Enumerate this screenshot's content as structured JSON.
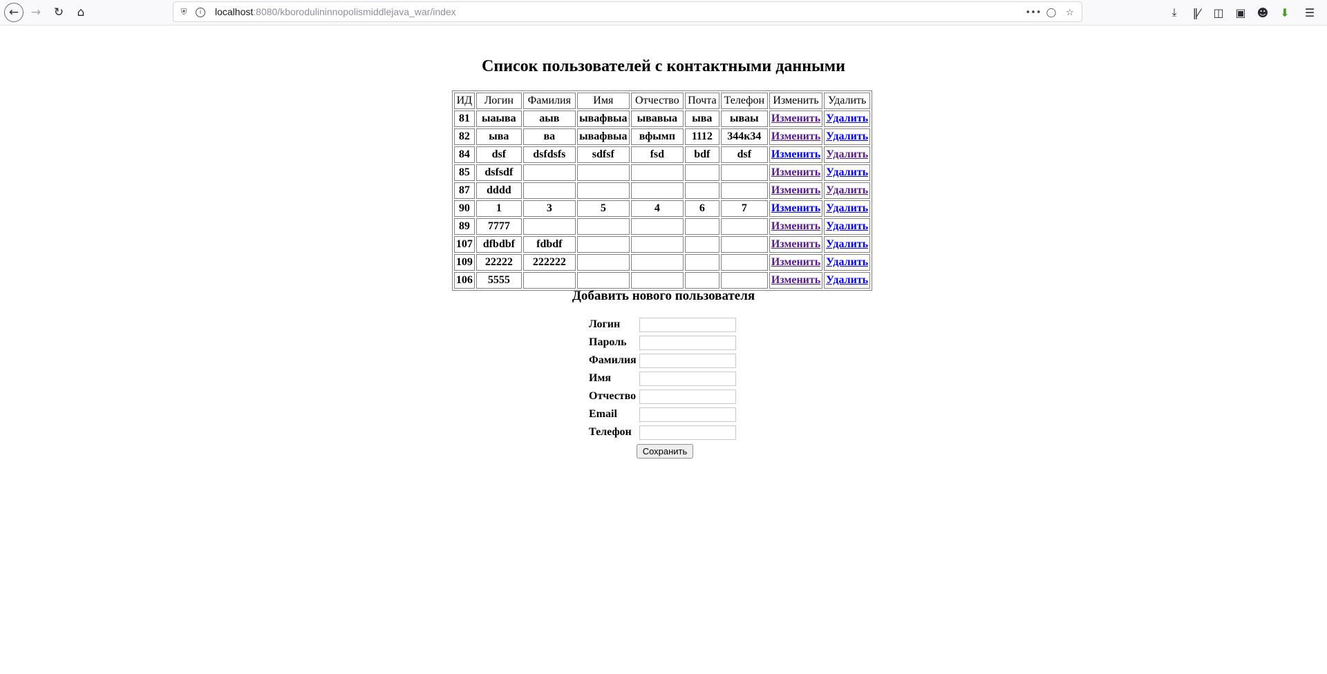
{
  "browser": {
    "url_host": "localhost",
    "url_path": ":8080/kborodulininnopolismiddlejava_war/index"
  },
  "page": {
    "title": "Список пользователей с контактными данными",
    "headers": [
      "ИД",
      "Логин",
      "Фамилия",
      "Имя",
      "Отчество",
      "Почта",
      "Телефон",
      "Изменить",
      "Удалить"
    ],
    "edit_label": "Изменить",
    "delete_label": "Удалить",
    "rows": [
      {
        "id": "81",
        "login": "ыаыва",
        "last": "аыв",
        "first": "ывафвыа",
        "middle": "ывавыа",
        "mail": "ыва",
        "phone": "ываы",
        "edit_visited": true,
        "del_visited": false
      },
      {
        "id": "82",
        "login": "ыва",
        "last": "ва",
        "first": "ывафвыа",
        "middle": "вфымп",
        "mail": "1112",
        "phone": "344к34",
        "edit_visited": true,
        "del_visited": false
      },
      {
        "id": "84",
        "login": "dsf",
        "last": "dsfdsfs",
        "first": "sdfsf",
        "middle": "fsd",
        "mail": "bdf",
        "phone": "dsf",
        "edit_visited": false,
        "del_visited": true
      },
      {
        "id": "85",
        "login": "dsfsdf",
        "last": "",
        "first": "",
        "middle": "",
        "mail": "",
        "phone": "",
        "edit_visited": true,
        "del_visited": false
      },
      {
        "id": "87",
        "login": "dddd",
        "last": "",
        "first": "",
        "middle": "",
        "mail": "",
        "phone": "",
        "edit_visited": true,
        "del_visited": true
      },
      {
        "id": "90",
        "login": "1",
        "last": "3",
        "first": "5",
        "middle": "4",
        "mail": "6",
        "phone": "7",
        "edit_visited": false,
        "del_visited": false
      },
      {
        "id": "89",
        "login": "7777",
        "last": "",
        "first": "",
        "middle": "",
        "mail": "",
        "phone": "",
        "edit_visited": true,
        "del_visited": false
      },
      {
        "id": "107",
        "login": "dfbdbf",
        "last": "fdbdf",
        "first": "",
        "middle": "",
        "mail": "",
        "phone": "",
        "edit_visited": true,
        "del_visited": false
      },
      {
        "id": "109",
        "login": "22222",
        "last": "222222",
        "first": "",
        "middle": "",
        "mail": "",
        "phone": "",
        "edit_visited": true,
        "del_visited": false
      },
      {
        "id": "106",
        "login": "5555",
        "last": "",
        "first": "",
        "middle": "",
        "mail": "",
        "phone": "",
        "edit_visited": true,
        "del_visited": false
      }
    ]
  },
  "add_form": {
    "title": "Добавить нового пользователя",
    "fields": [
      {
        "label": "Логин",
        "value": ""
      },
      {
        "label": "Пароль",
        "value": ""
      },
      {
        "label": "Фамилия",
        "value": ""
      },
      {
        "label": "Имя",
        "value": ""
      },
      {
        "label": "Отчество",
        "value": ""
      },
      {
        "label": "Email",
        "value": ""
      },
      {
        "label": "Телефон",
        "value": ""
      }
    ],
    "submit_label": "Сохранить"
  },
  "colors": {
    "link_visited": "#551a8b",
    "link_unvisited": "#0000ee"
  }
}
